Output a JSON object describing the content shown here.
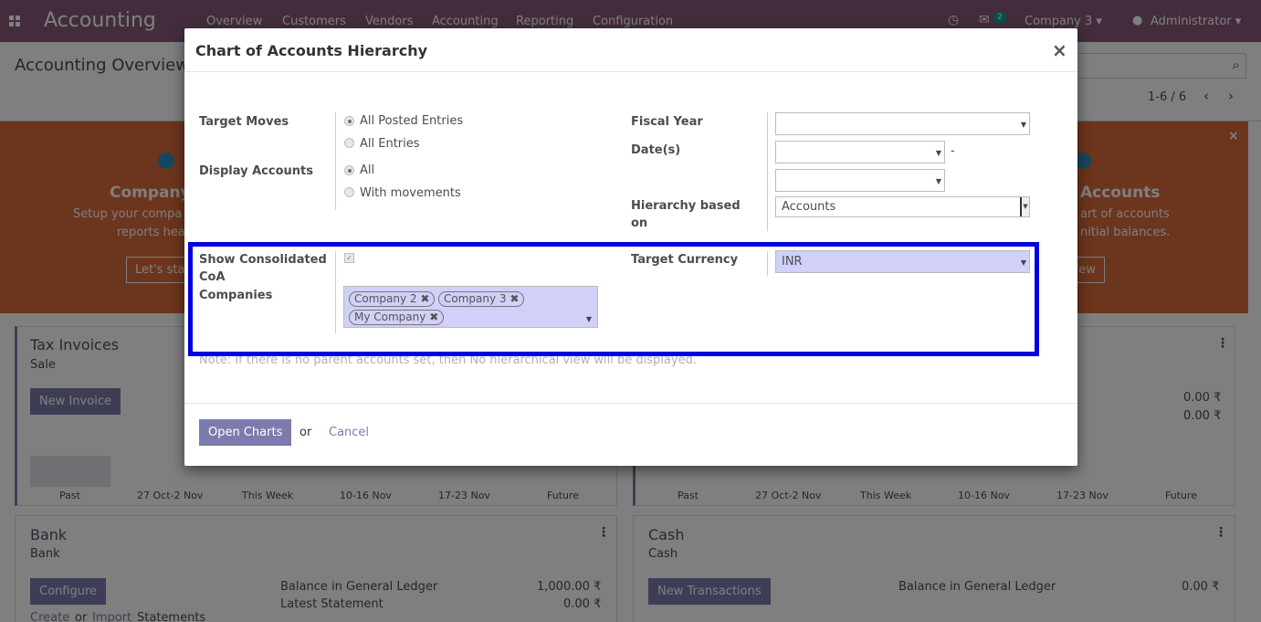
{
  "topbar": {
    "app_title": "Accounting",
    "menu": [
      "Overview",
      "Customers",
      "Vendors",
      "Accounting",
      "Reporting",
      "Configuration"
    ],
    "message_count": "2",
    "company": "Company 3",
    "user": "Administrator"
  },
  "control_panel": {
    "breadcrumb": "Accounting Overview",
    "pager": "1-6 / 6"
  },
  "banner": {
    "left_title": "Company",
    "left_text_1": "Setup your compa",
    "left_text_2": "reports hea",
    "left_button": "Let's sta",
    "right_title": "Accounts",
    "right_text_1": "art of accounts",
    "right_text_2": "nitial balances.",
    "right_button": "view"
  },
  "cards": {
    "tax_invoices": {
      "title": "Tax Invoices",
      "subtitle": "Sale",
      "button": "New Invoice",
      "axis": [
        "Past",
        "27 Oct-2 Nov",
        "This Week",
        "10-16 Nov",
        "17-23 Nov",
        "Future"
      ]
    },
    "right_top": {
      "amount_1": "0.00 ₹",
      "amount_2": "0.00 ₹",
      "axis": [
        "Past",
        "27 Oct-2 Nov",
        "This Week",
        "10-16 Nov",
        "17-23 Nov",
        "Future"
      ]
    },
    "bank": {
      "title": "Bank",
      "subtitle": "Bank",
      "button": "Configure",
      "balance_label": "Balance in General Ledger",
      "balance_value": "1,000.00 ₹",
      "statement_label": "Latest Statement",
      "statement_value": "0.00 ₹",
      "link_create": "Create",
      "link_or": "or",
      "link_import": "Import",
      "link_statements": "Statements"
    },
    "cash": {
      "title": "Cash",
      "subtitle": "Cash",
      "button": "New Transactions",
      "balance_label": "Balance in General Ledger",
      "balance_value": "0.00 ₹"
    }
  },
  "modal": {
    "title": "Chart of Accounts Hierarchy",
    "close": "×",
    "target_moves_label": "Target Moves",
    "target_moves_options": [
      "All Posted Entries",
      "All Entries"
    ],
    "target_moves_selected": "All Posted Entries",
    "display_accounts_label": "Display Accounts",
    "display_accounts_options": [
      "All",
      "With movements"
    ],
    "display_accounts_selected": "All",
    "fiscal_year_label": "Fiscal Year",
    "fiscal_year_value": "",
    "dates_label": "Date(s)",
    "date_from": "",
    "date_sep": "-",
    "date_to": "",
    "hierarchy_label": "Hierarchy based on",
    "hierarchy_value": "Accounts",
    "show_consolidated_label": "Show Consolidated CoA",
    "show_consolidated_checked": true,
    "companies_label": "Companies",
    "companies": [
      "Company 2",
      "Company 3",
      "My Company"
    ],
    "target_currency_label": "Target Currency",
    "target_currency_value": "INR",
    "note": "Note: If there is no parent accounts set, then No hierarchical view will be displayed.",
    "open_button": "Open Charts",
    "or_text": "or",
    "cancel_button": "Cancel"
  },
  "colors": {
    "brand": "#875a7b",
    "primary_button": "#7c7bad",
    "banner": "#d96a3a",
    "highlight_border": "#0000e0",
    "field_highlight": "#d0d0f8"
  }
}
